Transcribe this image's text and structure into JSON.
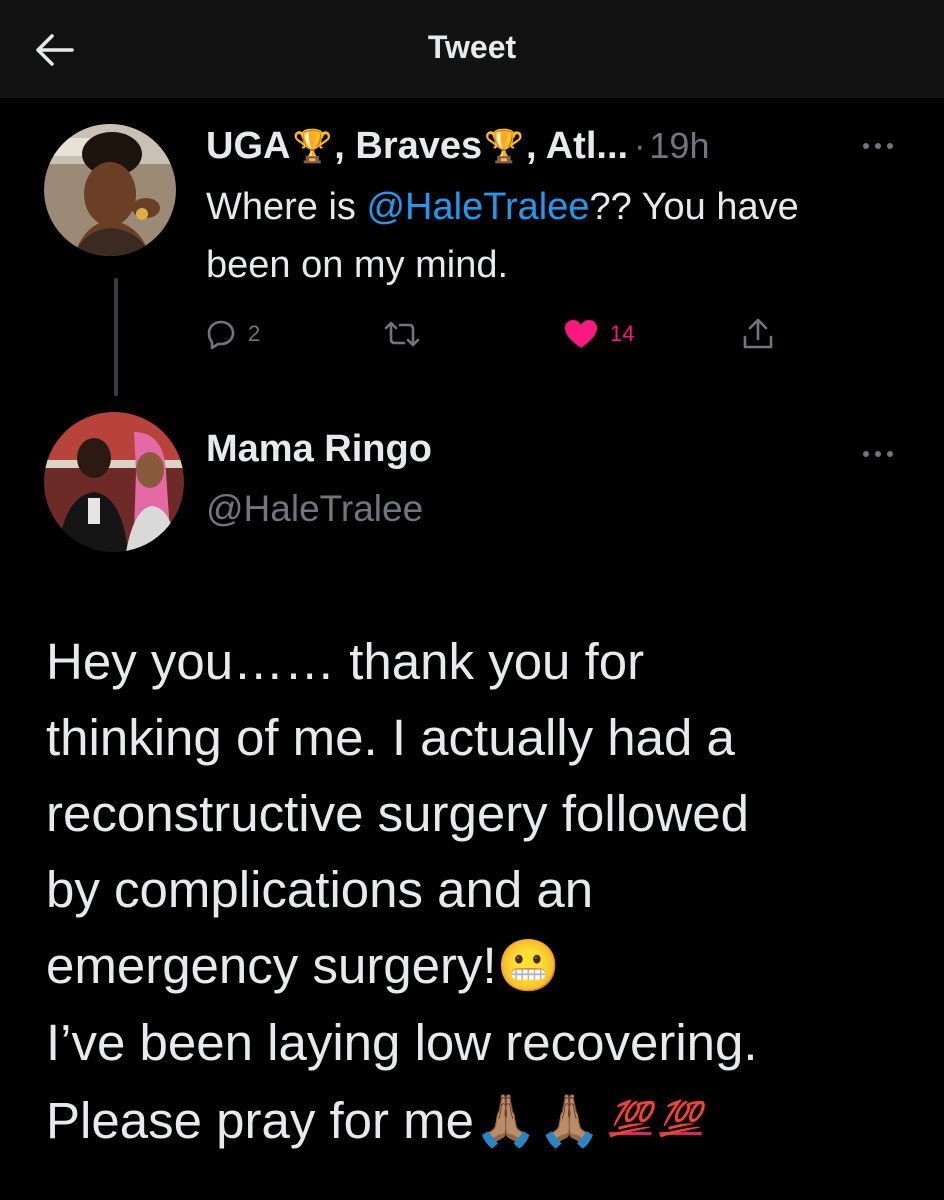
{
  "header": {
    "title": "Tweet",
    "back_icon": "arrow-left-icon"
  },
  "parent_tweet": {
    "name_parts": [
      "UGA",
      ", Braves ",
      ", Atl..."
    ],
    "trophy_emoji": "🏆",
    "separator": "·",
    "time": "19h",
    "text_before": "Where is ",
    "mention": "@HaleTralee",
    "text_after": "?? You have been on my mind.",
    "actions": {
      "replies": "2",
      "retweets": "",
      "likes": "14"
    },
    "like_color": "#f91880"
  },
  "main_tweet": {
    "name": "Mama Ringo",
    "handle": "@HaleTralee",
    "lines": [
      "Hey you…… thank you for",
      "thinking of me. I actually had a",
      "reconstructive surgery followed",
      "by complications and an",
      "emergency surgery!",
      "I’ve been laying low recovering.",
      "Please pray for me"
    ],
    "grimace_emoji": "😬",
    "pray_emoji": "🙏🏽",
    "hundred_emoji": "💯"
  },
  "colors": {
    "background": "#000000",
    "header_bg": "#121212",
    "text": "#e7e9ea",
    "muted": "#71767b",
    "link": "#1d9bf0"
  }
}
